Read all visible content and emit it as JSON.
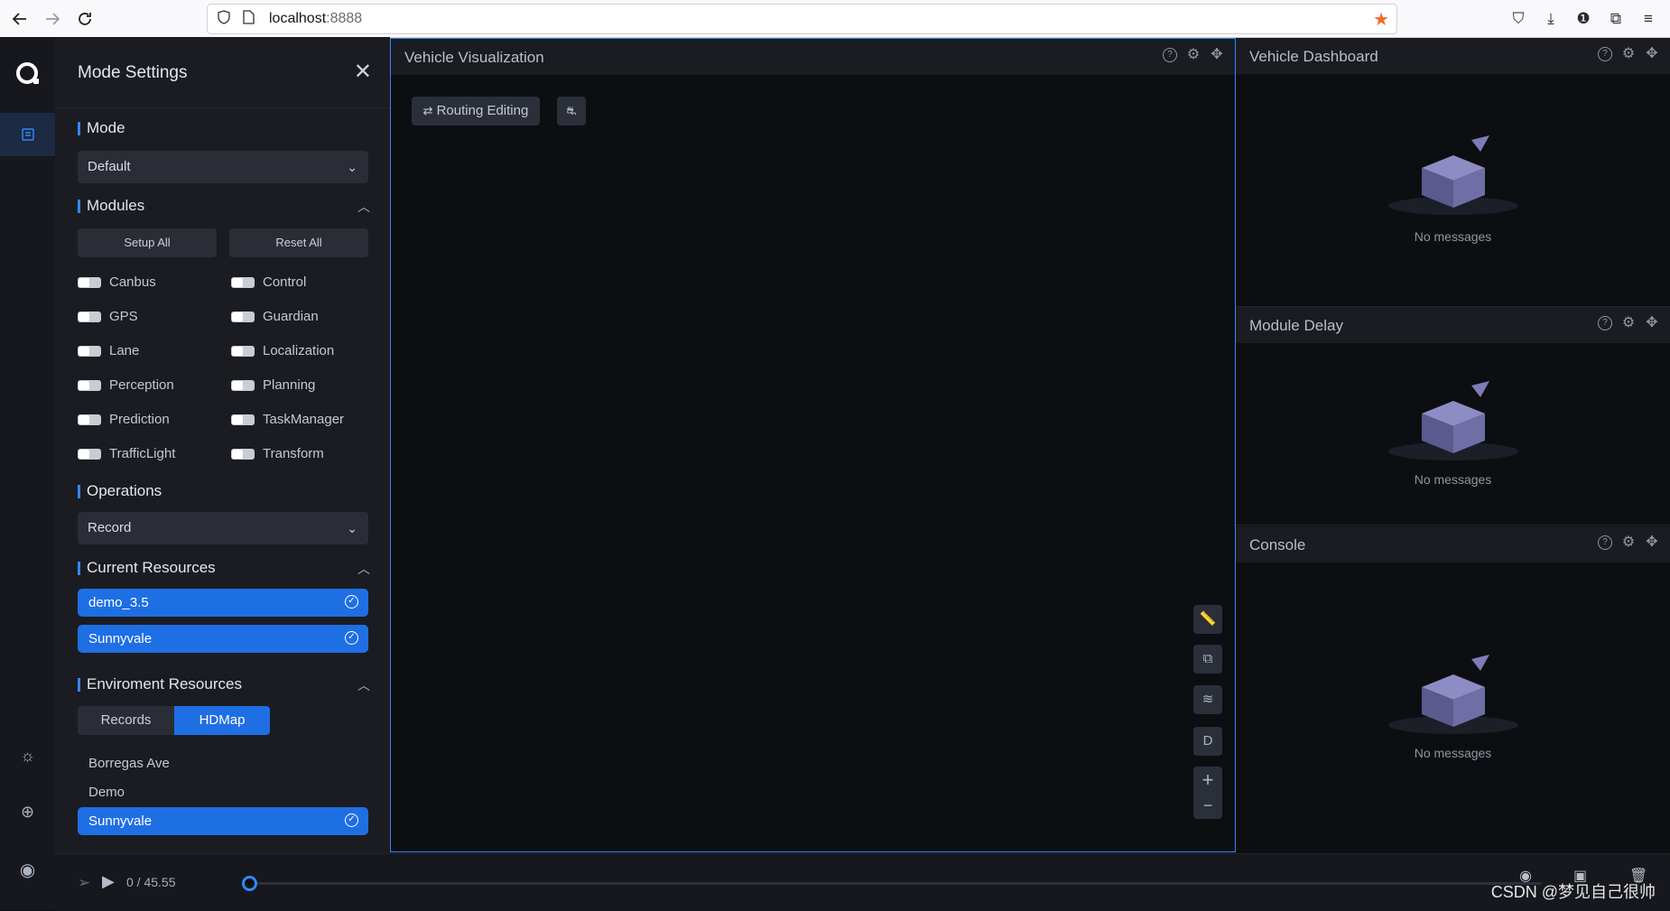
{
  "browser": {
    "url_host": "localhost",
    "url_port": ":8888",
    "back_icon": "arrow-left-icon",
    "forward_icon": "arrow-right-icon",
    "reload_icon": "reload-icon",
    "bookmark_color": "#f36b2a"
  },
  "settings": {
    "title": "Mode Settings",
    "mode_section": "Mode",
    "mode_value": "Default",
    "modules_section": "Modules",
    "setup_all": "Setup All",
    "reset_all": "Reset All",
    "modules": [
      {
        "label": "Canbus",
        "on": false
      },
      {
        "label": "Control",
        "on": false
      },
      {
        "label": "GPS",
        "on": false
      },
      {
        "label": "Guardian",
        "on": false
      },
      {
        "label": "Lane",
        "on": false
      },
      {
        "label": "Localization",
        "on": false
      },
      {
        "label": "Perception",
        "on": false
      },
      {
        "label": "Planning",
        "on": false
      },
      {
        "label": "Prediction",
        "on": false
      },
      {
        "label": "TaskManager",
        "on": false
      },
      {
        "label": "TrafficLight",
        "on": false
      },
      {
        "label": "Transform",
        "on": false
      }
    ],
    "operations_section": "Operations",
    "operations_value": "Record",
    "current_resources_section": "Current Resources",
    "current_resources": [
      "demo_3.5",
      "Sunnyvale"
    ],
    "env_resources_section": "Enviroment Resources",
    "tabs": [
      "Records",
      "HDMap"
    ],
    "active_tab": "HDMap",
    "maps": [
      {
        "label": "Borregas Ave",
        "selected": false
      },
      {
        "label": "Demo",
        "selected": false
      },
      {
        "label": "Sunnyvale",
        "selected": true
      }
    ]
  },
  "viz": {
    "title": "Vehicle Visualization",
    "routing_editing": "Routing Editing",
    "d_label": "D",
    "plus": "+",
    "minus": "−"
  },
  "panels": [
    {
      "title": "Vehicle Dashboard",
      "empty": "No messages"
    },
    {
      "title": "Module Delay",
      "empty": "No messages"
    },
    {
      "title": "Console",
      "empty": "No messages"
    }
  ],
  "playback": {
    "time": "0 / 45.55",
    "progress": 0
  },
  "watermark": "CSDN @梦见自己很帅",
  "colors": {
    "accent": "#3288fa",
    "selected": "#1f6fe4",
    "panel_bg": "#1a1c22"
  }
}
